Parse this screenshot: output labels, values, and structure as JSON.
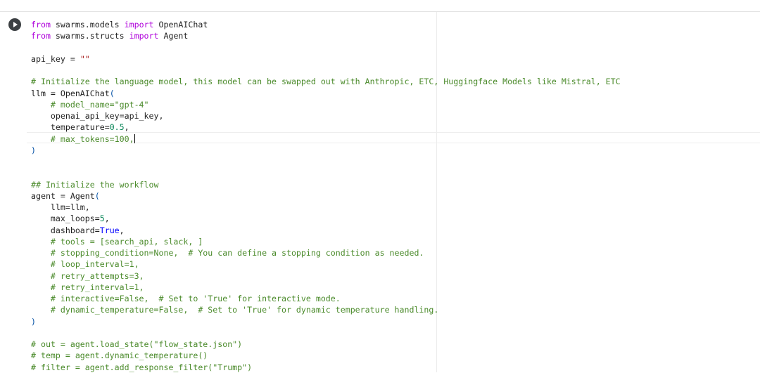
{
  "cell": {
    "run_button_icon": "play-icon",
    "lines": [
      [
        {
          "t": "from",
          "c": "kw"
        },
        {
          "t": " swarms.models ",
          "c": "fn"
        },
        {
          "t": "import",
          "c": "kw"
        },
        {
          "t": " OpenAIChat",
          "c": "fn"
        }
      ],
      [
        {
          "t": "from",
          "c": "kw"
        },
        {
          "t": " swarms.structs ",
          "c": "fn"
        },
        {
          "t": "import",
          "c": "kw"
        },
        {
          "t": " Agent",
          "c": "fn"
        }
      ],
      [],
      [
        {
          "t": "api_key = ",
          "c": "fn"
        },
        {
          "t": "\"\"",
          "c": "str"
        }
      ],
      [],
      [
        {
          "t": "# Initialize the language model, this model can be swapped out with Anthropic, ETC, Huggingface Models like Mistral, ETC",
          "c": "cm"
        }
      ],
      [
        {
          "t": "llm = OpenAIChat",
          "c": "fn"
        },
        {
          "t": "(",
          "c": "paren"
        }
      ],
      [
        {
          "t": "    ",
          "c": "fn"
        },
        {
          "t": "# model_name=\"gpt-4\"",
          "c": "cm"
        }
      ],
      [
        {
          "t": "    openai_api_key=api_key,",
          "c": "fn"
        }
      ],
      [
        {
          "t": "    temperature=",
          "c": "fn"
        },
        {
          "t": "0.5",
          "c": "num"
        },
        {
          "t": ",",
          "c": "fn"
        }
      ],
      [
        {
          "t": "    ",
          "c": "fn"
        },
        {
          "t": "# max_tokens=100,",
          "c": "cm"
        },
        {
          "t": "",
          "c": "cursor"
        }
      ],
      [
        {
          "t": ")",
          "c": "paren"
        }
      ],
      [],
      [],
      [
        {
          "t": "## Initialize the workflow",
          "c": "cm"
        }
      ],
      [
        {
          "t": "agent = Agent",
          "c": "fn"
        },
        {
          "t": "(",
          "c": "paren"
        }
      ],
      [
        {
          "t": "    llm=llm,",
          "c": "fn"
        }
      ],
      [
        {
          "t": "    max_loops=",
          "c": "fn"
        },
        {
          "t": "5",
          "c": "num"
        },
        {
          "t": ",",
          "c": "fn"
        }
      ],
      [
        {
          "t": "    dashboard=",
          "c": "fn"
        },
        {
          "t": "True",
          "c": "bool"
        },
        {
          "t": ",",
          "c": "fn"
        }
      ],
      [
        {
          "t": "    ",
          "c": "fn"
        },
        {
          "t": "# tools = [search_api, slack, ]",
          "c": "cm"
        }
      ],
      [
        {
          "t": "    ",
          "c": "fn"
        },
        {
          "t": "# stopping_condition=None,  # You can define a stopping condition as needed.",
          "c": "cm"
        }
      ],
      [
        {
          "t": "    ",
          "c": "fn"
        },
        {
          "t": "# loop_interval=1,",
          "c": "cm"
        }
      ],
      [
        {
          "t": "    ",
          "c": "fn"
        },
        {
          "t": "# retry_attempts=3,",
          "c": "cm"
        }
      ],
      [
        {
          "t": "    ",
          "c": "fn"
        },
        {
          "t": "# retry_interval=1,",
          "c": "cm"
        }
      ],
      [
        {
          "t": "    ",
          "c": "fn"
        },
        {
          "t": "# interactive=False,  # Set to 'True' for interactive mode.",
          "c": "cm"
        }
      ],
      [
        {
          "t": "    ",
          "c": "fn"
        },
        {
          "t": "# dynamic_temperature=False,  # Set to 'True' for dynamic temperature handling.",
          "c": "cm"
        }
      ],
      [
        {
          "t": ")",
          "c": "paren"
        }
      ],
      [],
      [
        {
          "t": "# out = agent.load_state(\"flow_state.json\")",
          "c": "cm"
        }
      ],
      [
        {
          "t": "# temp = agent.dynamic_temperature()",
          "c": "cm"
        }
      ],
      [
        {
          "t": "# filter = agent.add_response_filter(\"Trump\")",
          "c": "cm"
        }
      ]
    ]
  },
  "colors": {
    "keyword": "#af00db",
    "comment": "#4a8a2a",
    "number": "#098658",
    "boolean": "#0000ff",
    "paren": "#0451a5"
  }
}
